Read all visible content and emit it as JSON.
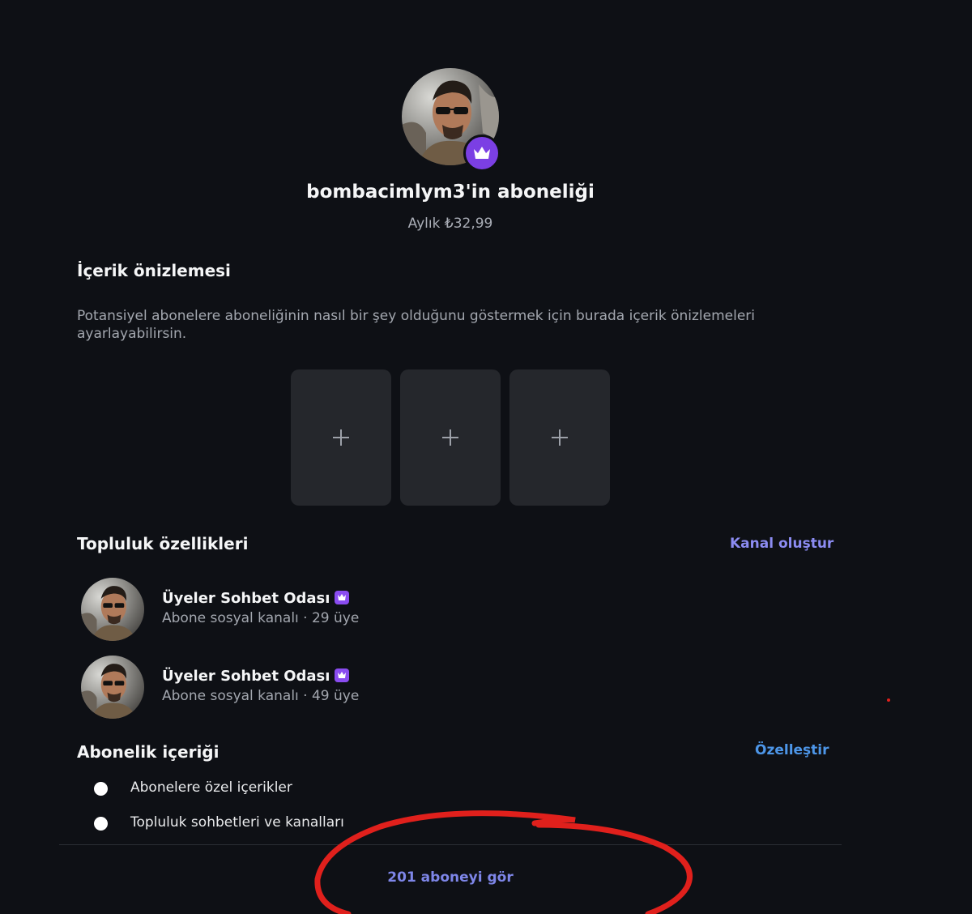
{
  "header": {
    "title": "bombacimlym3'in aboneliği",
    "price": "Aylık ₺32,99",
    "avatar_icon": "user-avatar",
    "badge_icon": "crown-icon",
    "badge_color": "#7b3fe4"
  },
  "preview": {
    "title": "İçerik önizlemesi",
    "description": "Potansiyel abonelere aboneliğinin nasıl bir şey olduğunu göstermek için burada içerik önizlemeleri ayarlayabilirsin.",
    "slots": [
      {
        "icon": "plus-icon"
      },
      {
        "icon": "plus-icon"
      },
      {
        "icon": "plus-icon"
      }
    ]
  },
  "community": {
    "title": "Topluluk özellikleri",
    "create_link": "Kanal oluştur",
    "channels": [
      {
        "name": "Üyeler Sohbet Odası",
        "subtitle": "Abone sosyal kanalı · 29 üye"
      },
      {
        "name": "Üyeler Sohbet Odası",
        "subtitle": "Abone sosyal kanalı · 49 üye"
      }
    ]
  },
  "content": {
    "title": "Abonelik içeriği",
    "customize_link": "Özelleştir",
    "items": [
      "Abonelere özel içerikler",
      "Topluluk sohbetleri ve kanalları"
    ]
  },
  "footer": {
    "see_subscribers": "201 aboneyi gör"
  },
  "colors": {
    "background": "#0e1015",
    "tile": "#25272c",
    "link_purple": "#8c8cf2",
    "link_blue": "#4d96e8",
    "annotation_red": "#e0201c"
  }
}
